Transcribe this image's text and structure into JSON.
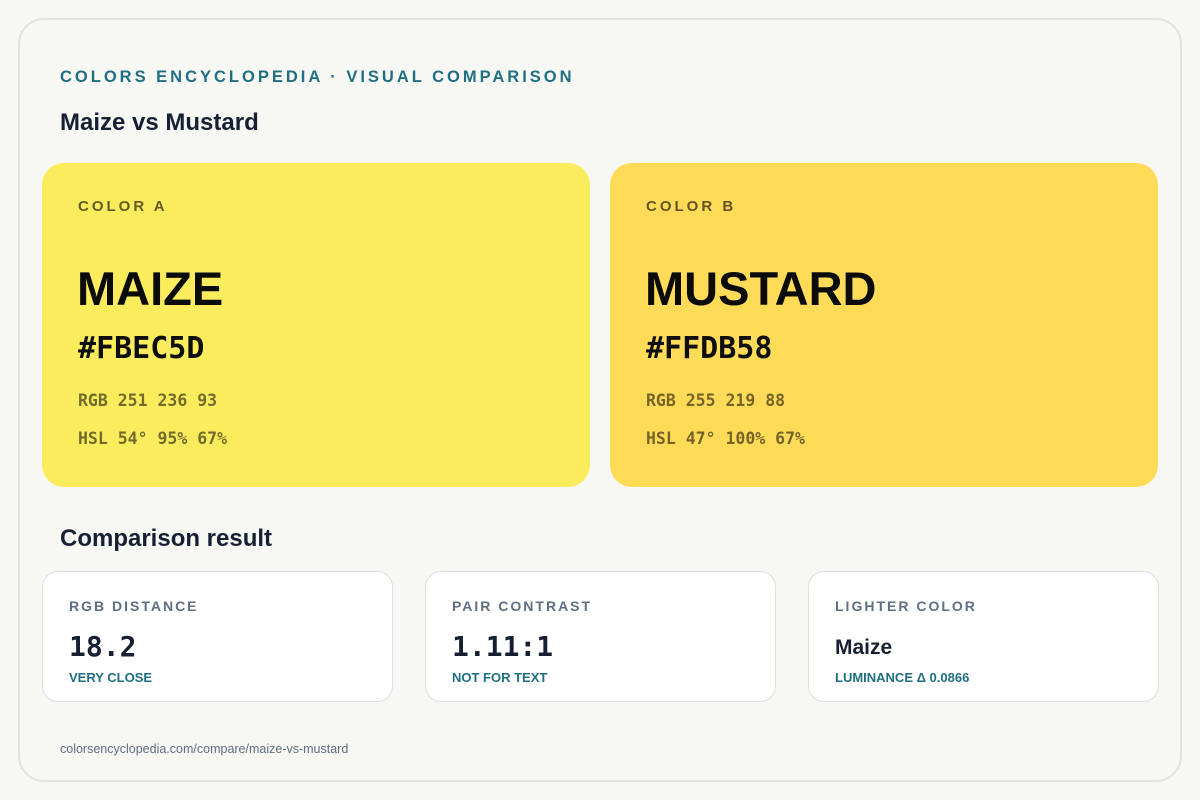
{
  "header": {
    "kicker": "COLORS ENCYCLOPEDIA · VISUAL COMPARISON",
    "title": "Maize vs Mustard"
  },
  "colors": [
    {
      "slot_label": "COLOR A",
      "name": "MAIZE",
      "hex": "#FBEC5D",
      "rgb": "RGB 251 236 93",
      "hsl": "HSL 54° 95% 67%",
      "swatch_color": "#fbec5d"
    },
    {
      "slot_label": "COLOR B",
      "name": "MUSTARD",
      "hex": "#FFDB58",
      "rgb": "RGB 255 219 88",
      "hsl": "HSL 47° 100% 67%",
      "swatch_color": "#ffdb58"
    }
  ],
  "comparison": {
    "title": "Comparison result",
    "cards": [
      {
        "label": "RGB DISTANCE",
        "value": "18.2",
        "note": "VERY CLOSE"
      },
      {
        "label": "PAIR CONTRAST",
        "value": "1.11:1",
        "note": "NOT FOR TEXT"
      },
      {
        "label": "LIGHTER COLOR",
        "value": "Maize",
        "note": "LUMINANCE Δ 0.0866"
      }
    ]
  },
  "footer": {
    "url": "colorsencyclopedia.com/compare/maize-vs-mustard"
  },
  "theme": {
    "accent": "#1f6f82",
    "heading": "#172033",
    "muted": "#5f6e80",
    "background": "#f7f7f4"
  }
}
